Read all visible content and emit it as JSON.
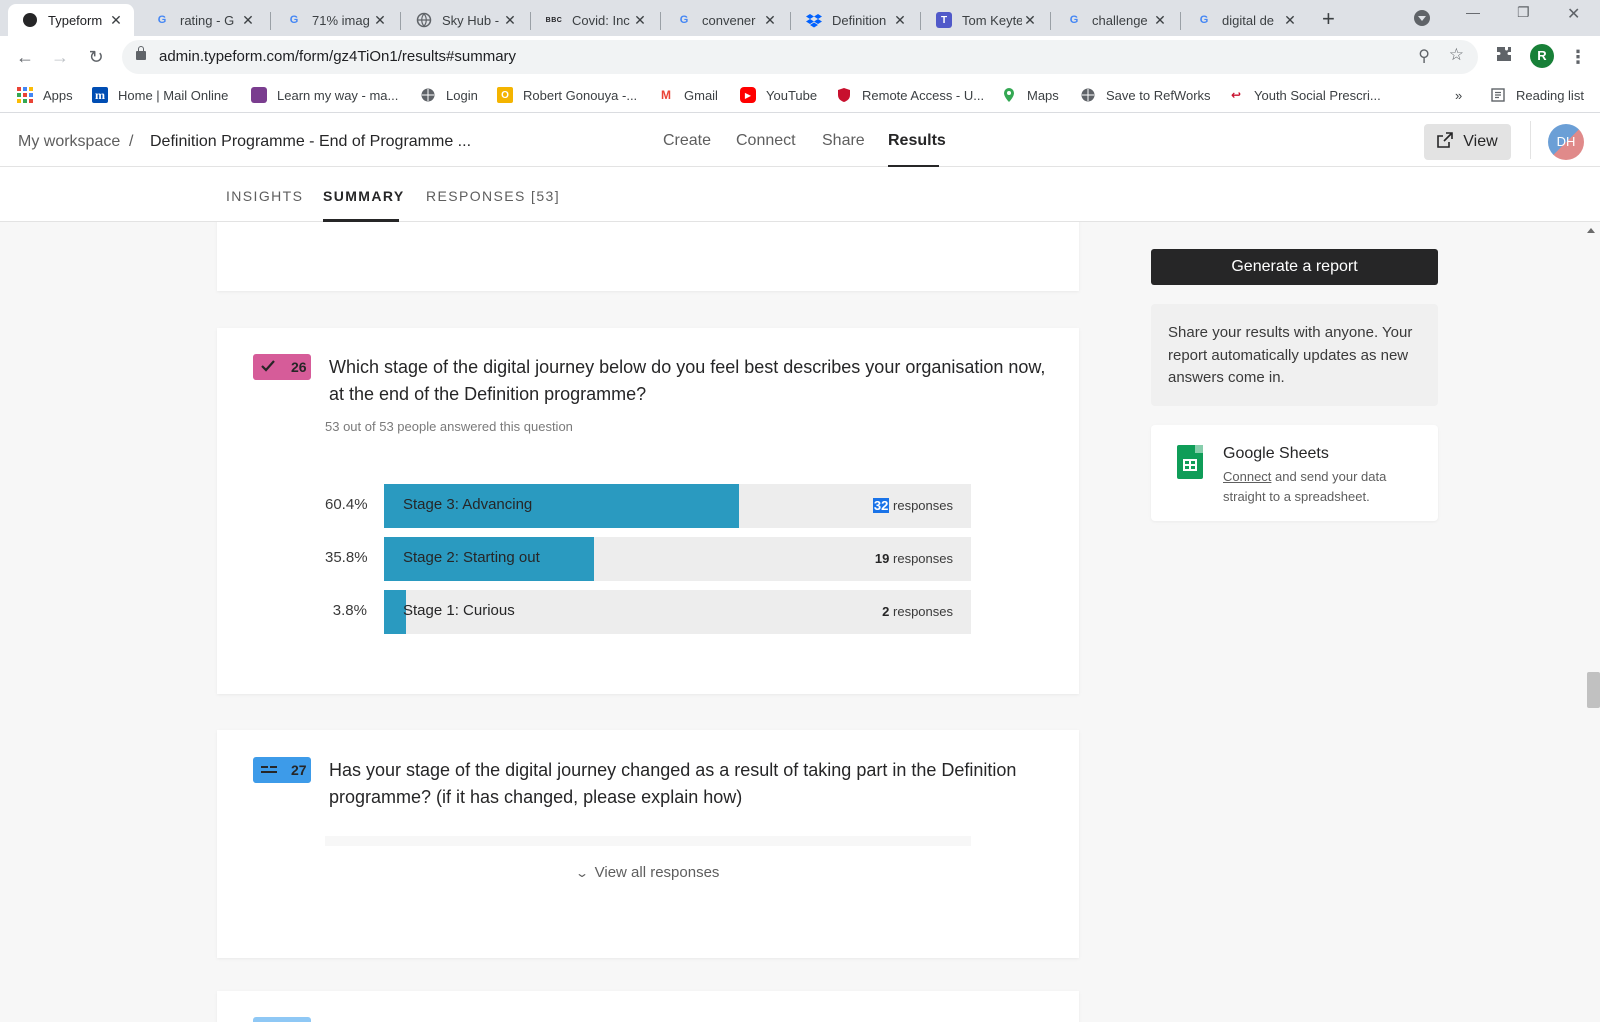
{
  "browser": {
    "tabs": [
      {
        "title": "Typeform",
        "icon": "typeform-icon"
      },
      {
        "title": "rating - G",
        "icon": "google-icon"
      },
      {
        "title": "71% imag",
        "icon": "google-icon"
      },
      {
        "title": "Sky Hub -",
        "icon": "globe-icon"
      },
      {
        "title": "Covid: Inc",
        "icon": "bbc-icon"
      },
      {
        "title": "convener",
        "icon": "google-icon"
      },
      {
        "title": "Definition",
        "icon": "dropbox-icon"
      },
      {
        "title": "Tom Keyte",
        "icon": "teams-icon"
      },
      {
        "title": "challenge",
        "icon": "google-icon"
      },
      {
        "title": "digital de",
        "icon": "google-icon"
      }
    ],
    "url": "admin.typeform.com/form/gz4TiOn1/results#summary",
    "profile_initial": "R",
    "bookmarks": [
      {
        "label": "Apps"
      },
      {
        "label": "Home | Mail Online",
        "icon_text": "m"
      },
      {
        "label": "Learn my way - ma..."
      },
      {
        "label": "Login"
      },
      {
        "label": "Robert Gonouya -..."
      },
      {
        "label": "Gmail"
      },
      {
        "label": "YouTube"
      },
      {
        "label": "Remote Access - U..."
      },
      {
        "label": "Maps"
      },
      {
        "label": "Save to RefWorks"
      },
      {
        "label": "Youth Social Prescri..."
      }
    ],
    "bookmarks_overflow": "»",
    "reading_list": "Reading list"
  },
  "header": {
    "workspace": "My workspace",
    "separator": "/",
    "form_title": "Definition Programme - End of Programme ...",
    "nav": [
      "Create",
      "Connect",
      "Share",
      "Results"
    ],
    "active_nav": "Results",
    "view_label": "View",
    "avatar_initials": "DH"
  },
  "subnav": {
    "tabs": [
      "INSIGHTS",
      "SUMMARY",
      "RESPONSES [53]"
    ],
    "active": "SUMMARY"
  },
  "questions": [
    {
      "number": "26",
      "type_icon": "checkmark-icon",
      "badge_color": "#d65c99",
      "title": "Which stage of the digital journey below do you feel best describes your organisation now, at the end of the Definition programme?",
      "answered": "53 out of 53 people answered this question",
      "responses_word": "responses",
      "results": [
        {
          "label": "Stage 3: Advancing",
          "percent_text": "60.4%",
          "percent": 60.4,
          "count": "32"
        },
        {
          "label": "Stage 2: Starting out",
          "percent_text": "35.8%",
          "percent": 35.8,
          "count": "19"
        },
        {
          "label": "Stage 1: Curious",
          "percent_text": "3.8%",
          "percent": 3.8,
          "count": "2"
        }
      ]
    },
    {
      "number": "27",
      "type_icon": "long-text-icon",
      "badge_color": "#3d9be9",
      "title": "Has your stage of the digital journey changed as a result of taking part in the Definition programme? (if it has changed, please explain how)",
      "view_all": "View all responses"
    }
  ],
  "sidebar": {
    "generate_report": "Generate a report",
    "share_text": "Share your results with anyone. Your report automatically updates as new answers come in.",
    "sheets_title": "Google Sheets",
    "sheets_link": "Connect",
    "sheets_rest": " and send your data straight to a spreadsheet."
  },
  "colors": {
    "bar_fill": "#2a9ac0",
    "bar_track": "#ededed",
    "selection": "#1a73e8"
  }
}
